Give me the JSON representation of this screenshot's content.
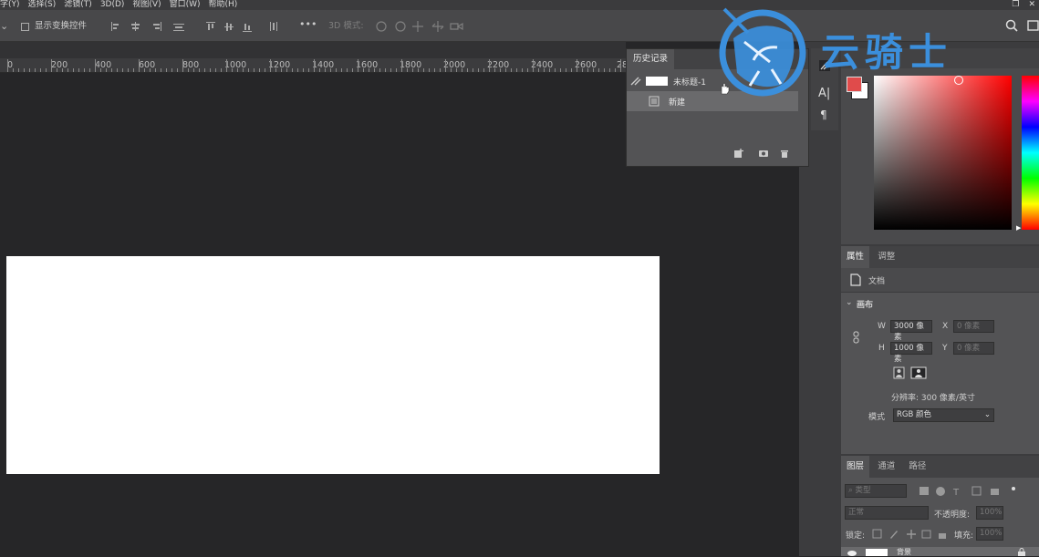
{
  "menu": [
    "字(Y)",
    "选择(S)",
    "滤镜(T)",
    "3D(D)",
    "视图(V)",
    "窗口(W)",
    "帮助(H)"
  ],
  "options": {
    "show_transform": "显示变换控件",
    "three_d_mode": "3D 模式:",
    "more": "•••"
  },
  "ruler": [
    "0",
    "200",
    "400",
    "600",
    "800",
    "1000",
    "1200",
    "1400",
    "1600",
    "1800",
    "2000",
    "2200",
    "2400",
    "2600",
    "28"
  ],
  "history": {
    "tab": "历史记录",
    "doc_name": "未标题-1",
    "step": "新建"
  },
  "color": {
    "foreground": "#e04b4b",
    "background": "#ffffff"
  },
  "properties": {
    "tabs": [
      "属性",
      "调整"
    ],
    "doc_label": "文档",
    "canvas_section": "画布",
    "w_label": "W",
    "w_value": "3000 像素",
    "h_label": "H",
    "h_value": "1000 像素",
    "x_label": "X",
    "x_placeholder": "0 像素",
    "y_label": "Y",
    "y_placeholder": "0 像素",
    "resolution": "分辨率: 300 像素/英寸",
    "mode_label": "模式",
    "mode_value": "RGB 颜色"
  },
  "layers": {
    "tabs": [
      "图层",
      "通道",
      "路径"
    ],
    "filter_placeholder": "类型",
    "blend": "正常",
    "opacity_label": "不透明度:",
    "opacity_value": "100%",
    "lock_label": "锁定:",
    "fill_label": "填充:",
    "fill_value": "100%",
    "layer_name": "背景"
  },
  "watermark": {
    "text": "云骑士"
  }
}
